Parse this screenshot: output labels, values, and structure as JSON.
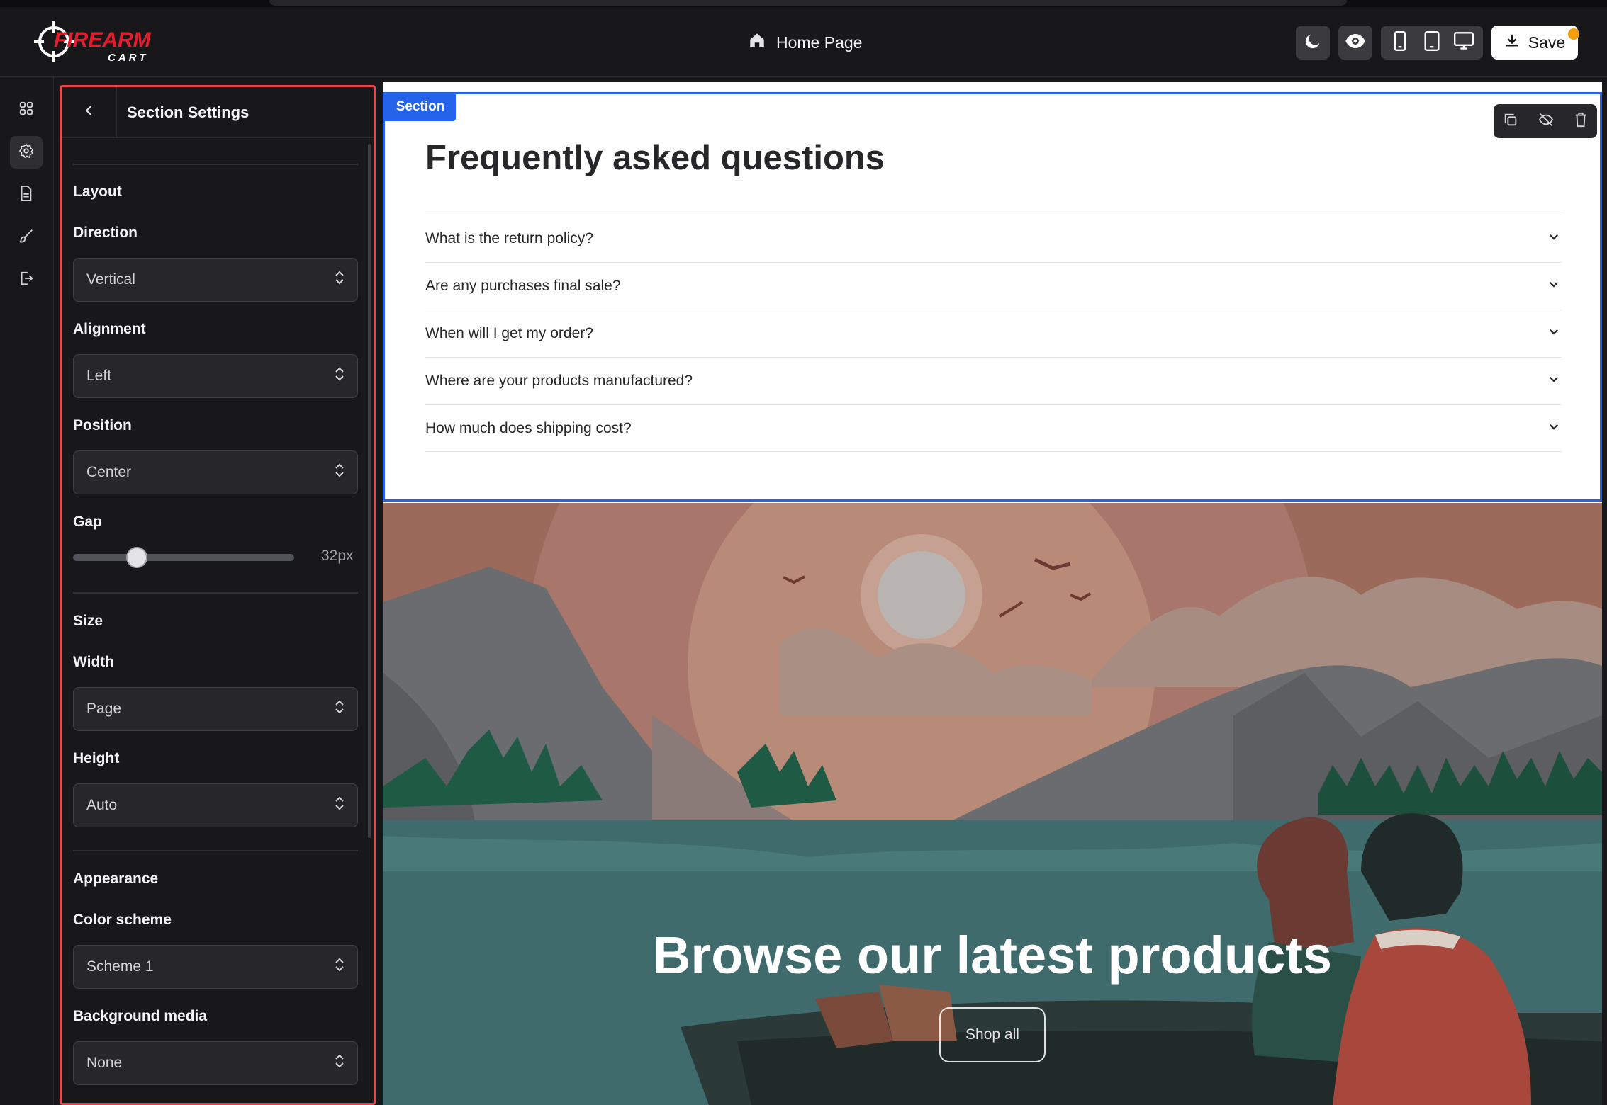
{
  "topbar": {
    "logo": {
      "word1": "FIREARM",
      "word2": "CART"
    },
    "page_title": "Home Page",
    "save_label": "Save",
    "icons": [
      "moon-icon",
      "eye-icon",
      "mobile-icon",
      "tablet-icon",
      "desktop-icon",
      "download-icon",
      "home-icon"
    ]
  },
  "rail": {
    "icons": [
      "grid-icon",
      "gear-icon",
      "document-icon",
      "brush-icon",
      "exit-icon"
    ],
    "active": "gear-icon"
  },
  "panel": {
    "title": "Section Settings",
    "layout": {
      "heading": "Layout",
      "direction": {
        "label": "Direction",
        "value": "Vertical"
      },
      "alignment": {
        "label": "Alignment",
        "value": "Left"
      },
      "position": {
        "label": "Position",
        "value": "Center"
      },
      "gap": {
        "label": "Gap",
        "value": "32px",
        "fraction": 0.25
      }
    },
    "size": {
      "heading": "Size",
      "width": {
        "label": "Width",
        "value": "Page"
      },
      "height": {
        "label": "Height",
        "value": "Auto"
      }
    },
    "appearance": {
      "heading": "Appearance",
      "color_scheme": {
        "label": "Color scheme",
        "value": "Scheme 1"
      },
      "background_media": {
        "label": "Background media",
        "value": "None"
      }
    }
  },
  "canvas": {
    "section_badge": "Section",
    "faq": {
      "title": "Frequently asked questions",
      "items": [
        "What is the return policy?",
        "Are any purchases final sale?",
        "When will I get my order?",
        "Where are your products manufactured?",
        "How much does shipping cost?"
      ]
    },
    "hero": {
      "title": "Browse our latest products",
      "button": "Shop all"
    }
  },
  "colors": {
    "accent_blue": "#2563eb",
    "selection_red": "#e5484d",
    "panel_bg": "#18181b",
    "save_dot": "#f59e0b"
  }
}
